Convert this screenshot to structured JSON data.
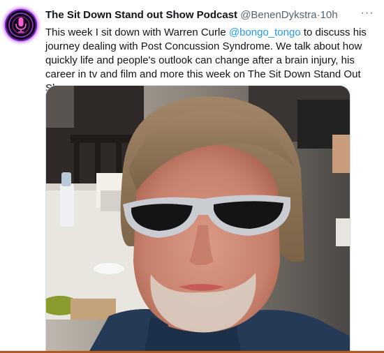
{
  "tweet": {
    "display_name": "The Sit Down Stand out Show Podcast",
    "handle": "@BenenDykstra",
    "separator": "·",
    "time": "10h",
    "more_label": "···",
    "text_before": "This week I sit down with Warren Curle ",
    "mention": "@bongo_tongo",
    "text_after": " to discuss his journey dealing with Post Concussion Syndrome. We talk about how quickly life and people's outlook can change after a brain injury, his career in tv and film and more this week on The Sit Down Stand Out Show."
  },
  "avatar": {
    "icon": "microphone-icon",
    "accent": "#b33cff"
  },
  "colors": {
    "mention": "#1d9bf0",
    "text": "#0f1419",
    "muted": "#536471"
  }
}
